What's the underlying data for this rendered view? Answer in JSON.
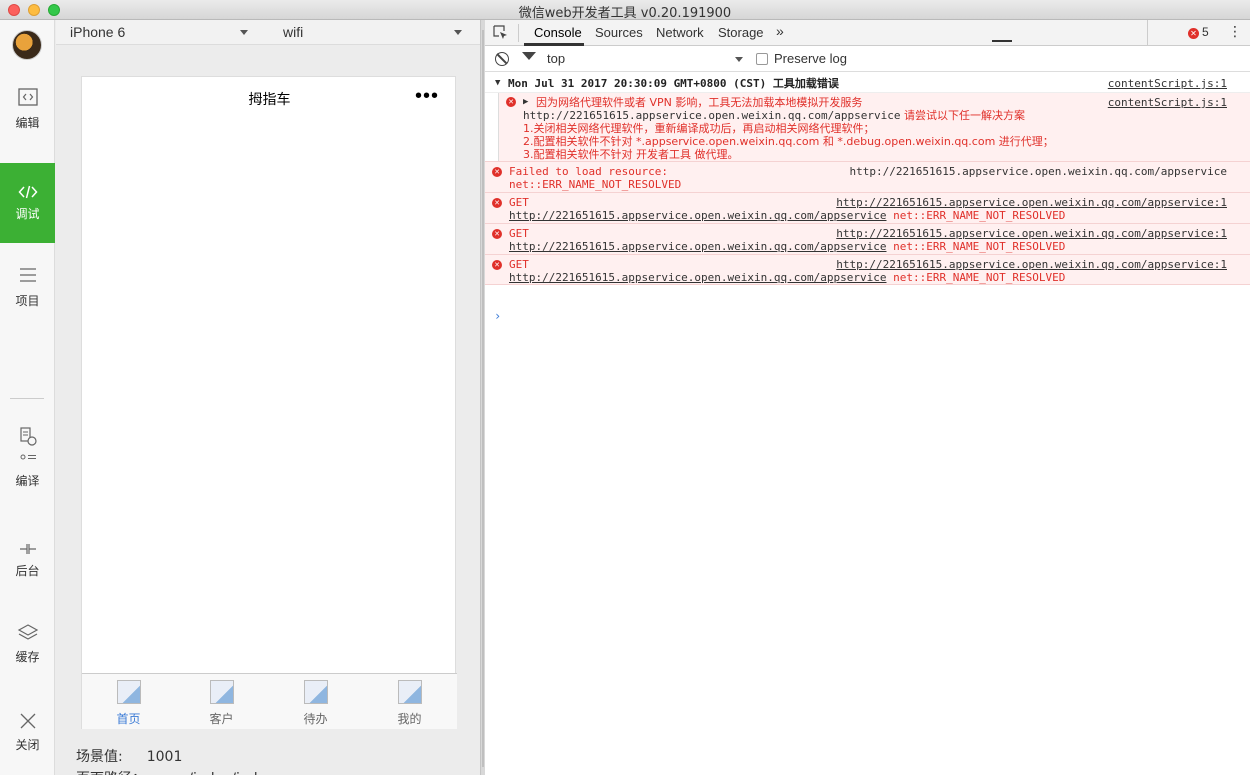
{
  "window": {
    "title": "微信web开发者工具 v0.20.191900"
  },
  "sidebar": {
    "items": [
      {
        "label": "编辑",
        "icon": "code-box-icon"
      },
      {
        "label": "调试",
        "icon": "code-brackets-icon"
      },
      {
        "label": "项目",
        "icon": "menu-lines-icon"
      },
      {
        "label": "编译",
        "icon": "compile-icon"
      },
      {
        "label": "后台",
        "icon": "background-icon"
      },
      {
        "label": "缓存",
        "icon": "layers-icon"
      },
      {
        "label": "关闭",
        "icon": "close-icon"
      }
    ]
  },
  "device_bar": {
    "device": "iPhone 6",
    "network": "wifi"
  },
  "phone": {
    "title": "拇指车",
    "more": "•••",
    "tabs": [
      {
        "label": "首页"
      },
      {
        "label": "客户"
      },
      {
        "label": "待办"
      },
      {
        "label": "我的"
      }
    ],
    "active_tab": "首页"
  },
  "scene": {
    "label": "场景值:",
    "value": "1001",
    "path_label": "页面路径：pages/index/index"
  },
  "devtools": {
    "tabs": [
      "Console",
      "Sources",
      "Network",
      "Storage"
    ],
    "active_tab": "Console",
    "more": "»",
    "error_count": "5",
    "kebab": "⋮",
    "filter": {
      "context": "top",
      "preserve_log": "Preserve log"
    }
  },
  "console": {
    "group_title": "Mon Jul 31 2017 20:30:09 GMT+0800 (CST) 工具加载错误",
    "group_source": "contentScript.js:1",
    "grouped_error": {
      "line1_a": "因为网络代理软件或者 VPN 影响，工具无法加载本地模拟开发服务",
      "line2_url": "http://221651615.appservice.open.weixin.qq.com/appservice",
      "line2_b": "请尝试以下任一解决方案",
      "line3": "1.关闭相关网络代理软件，重新编译成功后，再启动相关网络代理软件；",
      "line4": "2.配置相关软件不针对 *.appservice.open.weixin.qq.com 和 *.debug.open.weixin.qq.com 进行代理；",
      "line5": "3.配置相关软件不针对 开发者工具 做代理。",
      "source": "contentScript.js:1"
    },
    "errors": [
      {
        "line1": "Failed to load resource:",
        "line2": "net::ERR_NAME_NOT_RESOLVED",
        "right": "http://221651615.appservice.open.weixin.qq.com/appservice"
      },
      {
        "line1": "GET",
        "right": "http://221651615.appservice.open.weixin.qq.com/appservice:1",
        "url": "http://221651615.appservice.open.weixin.qq.com/appservice",
        "err": "net::ERR_NAME_NOT_RESOLVED"
      },
      {
        "line1": "GET",
        "right": "http://221651615.appservice.open.weixin.qq.com/appservice:1",
        "url": "http://221651615.appservice.open.weixin.qq.com/appservice",
        "err": "net::ERR_NAME_NOT_RESOLVED"
      },
      {
        "line1": "GET",
        "right": "http://221651615.appservice.open.weixin.qq.com/appservice:1",
        "url": "http://221651615.appservice.open.weixin.qq.com/appservice",
        "err": "net::ERR_NAME_NOT_RESOLVED"
      }
    ],
    "prompt": "›"
  },
  "colors": {
    "accent_green": "#3cb034",
    "error_red": "#e0302a",
    "error_bg": "#fff0f0",
    "link_blue": "#3b7bd6"
  }
}
